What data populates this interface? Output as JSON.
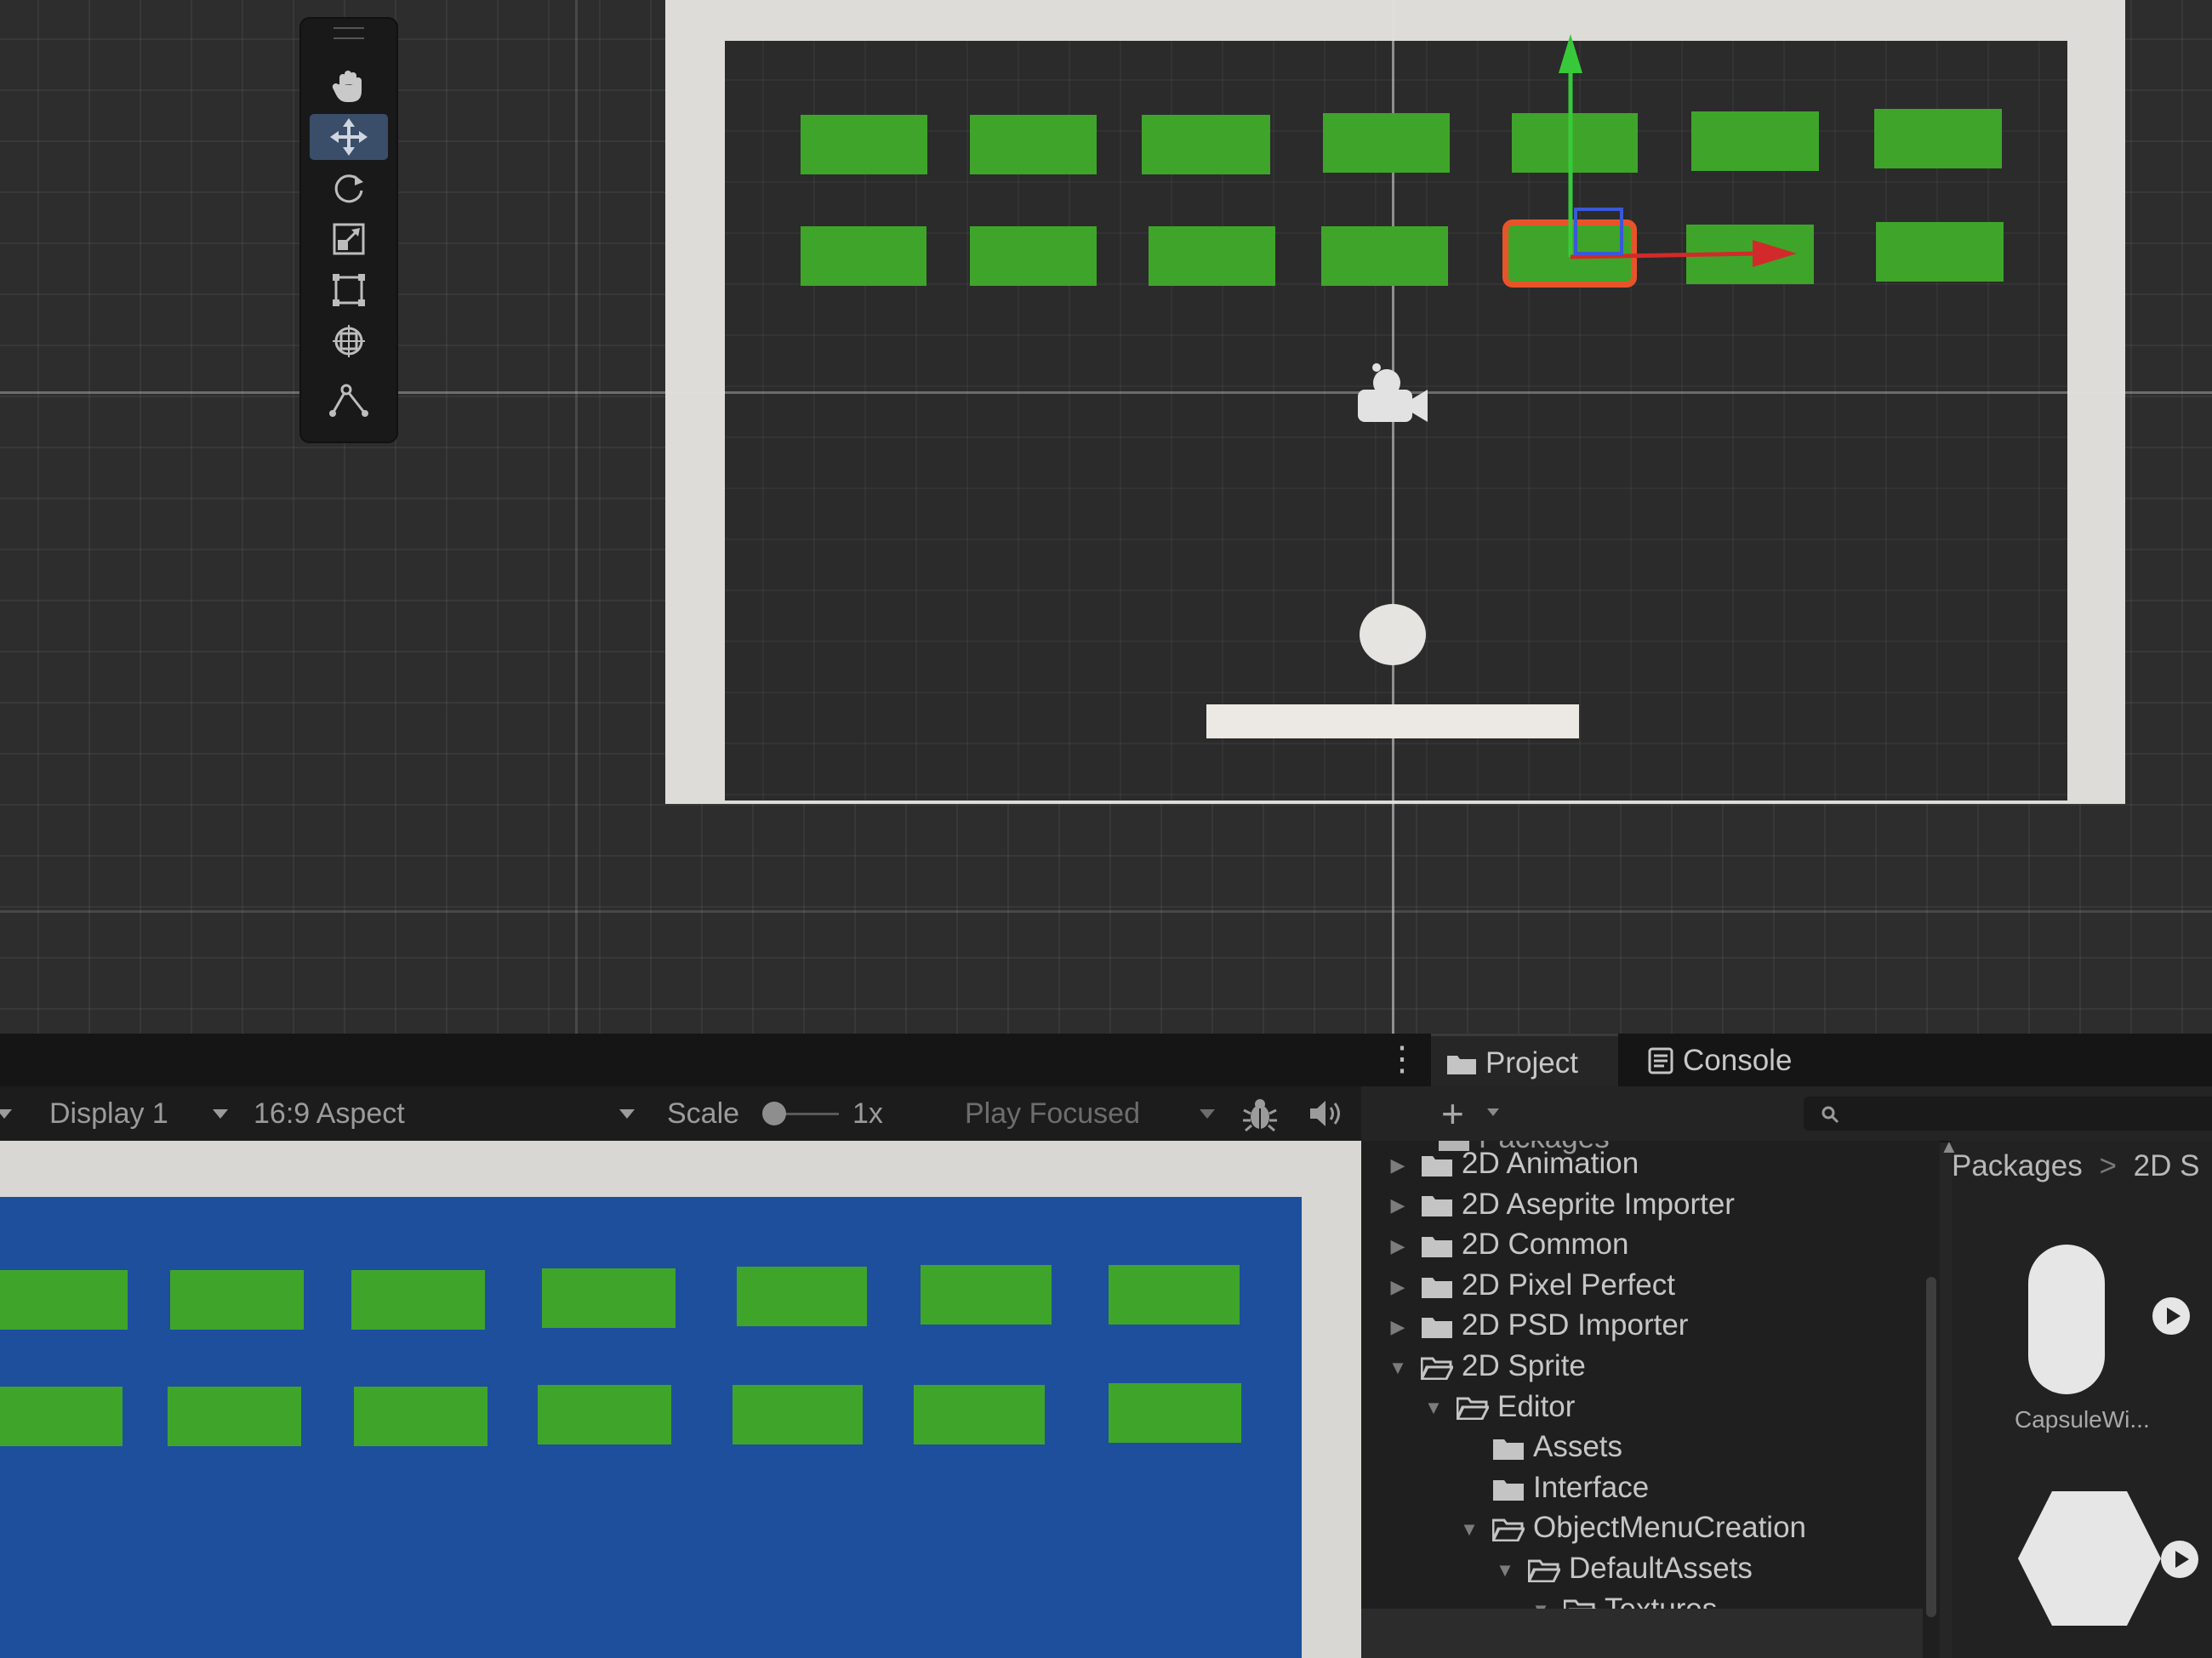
{
  "game_toolbar": {
    "display": "Display 1",
    "aspect": "16:9 Aspect",
    "scale_label": "Scale",
    "scale_value": "1x",
    "play_mode": "Play Focused"
  },
  "panel_tabs": [
    {
      "label": "Project",
      "icon": "folder-icon",
      "active": true
    },
    {
      "label": "Console",
      "icon": "console-icon",
      "active": false
    }
  ],
  "project_tree": {
    "root_partial": "Packages",
    "items": [
      {
        "label": "2D Animation",
        "depth": 0,
        "expanded": false
      },
      {
        "label": "2D Aseprite Importer",
        "depth": 0,
        "expanded": false
      },
      {
        "label": "2D Common",
        "depth": 0,
        "expanded": false
      },
      {
        "label": "2D Pixel Perfect",
        "depth": 0,
        "expanded": false
      },
      {
        "label": "2D PSD Importer",
        "depth": 0,
        "expanded": false
      },
      {
        "label": "2D Sprite",
        "depth": 0,
        "expanded": true
      },
      {
        "label": "Editor",
        "depth": 1,
        "expanded": true
      },
      {
        "label": "Assets",
        "depth": 2,
        "expanded": false
      },
      {
        "label": "Interface",
        "depth": 2,
        "expanded": false
      },
      {
        "label": "ObjectMenuCreation",
        "depth": 2,
        "expanded": true
      },
      {
        "label": "DefaultAssets",
        "depth": 3,
        "expanded": true
      },
      {
        "label": "Textures",
        "depth": 4,
        "expanded": true,
        "selected": true
      }
    ]
  },
  "breadcrumb": {
    "root": "Packages",
    "separator": ">",
    "current_partial": "2D S"
  },
  "assets": [
    {
      "label": "CapsuleWi...",
      "shape": "capsule"
    },
    {
      "label": "",
      "shape": "hexagon"
    }
  ],
  "colors": {
    "brick": "#3ea52a",
    "game_background": "#1e4f9c",
    "selection_outline": "#e8542a",
    "gizmo_x": "#d22a2a",
    "gizmo_y": "#38c93a",
    "active_tool": "#3a4e6a"
  },
  "tools": [
    {
      "name": "hand-tool-icon",
      "active": false
    },
    {
      "name": "move-tool-icon",
      "active": true
    },
    {
      "name": "rotate-tool-icon",
      "active": false
    },
    {
      "name": "scale-tool-icon",
      "active": false
    },
    {
      "name": "rect-tool-icon",
      "active": false
    },
    {
      "name": "transform-tool-icon",
      "active": false
    },
    {
      "name": "custom-tool-icon",
      "active": false
    }
  ]
}
